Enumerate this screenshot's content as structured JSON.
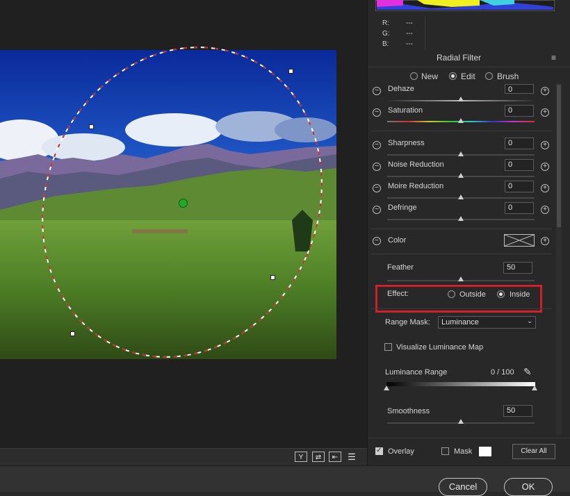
{
  "rgb": {
    "r_label": "R:",
    "g_label": "G:",
    "b_label": "B:",
    "r_value": "---",
    "g_value": "---",
    "b_value": "---"
  },
  "panel": {
    "title": "Radial Filter",
    "menu_icon": "hamburger-icon"
  },
  "modes": {
    "new": "New",
    "edit": "Edit",
    "brush": "Brush",
    "selected": "Edit"
  },
  "adjustments": {
    "dehaze": {
      "label": "Dehaze",
      "value": "0"
    },
    "saturation": {
      "label": "Saturation",
      "value": "0"
    },
    "sharpness": {
      "label": "Sharpness",
      "value": "0"
    },
    "noise_reduction": {
      "label": "Noise Reduction",
      "value": "0"
    },
    "moire_reduction": {
      "label": "Moire Reduction",
      "value": "0"
    },
    "defringe": {
      "label": "Defringe",
      "value": "0"
    },
    "color": {
      "label": "Color"
    }
  },
  "feather": {
    "label": "Feather",
    "value": "50"
  },
  "effect": {
    "label": "Effect:",
    "outside": "Outside",
    "inside": "Inside",
    "selected": "Inside"
  },
  "range_mask": {
    "label": "Range Mask:",
    "value": "Luminance"
  },
  "visualize": {
    "label": "Visualize Luminance Map",
    "checked": false
  },
  "luminance_range": {
    "label": "Luminance Range",
    "value": "0 / 100"
  },
  "smoothness": {
    "label": "Smoothness",
    "value": "50"
  },
  "footer": {
    "overlay": "Overlay",
    "overlay_checked": true,
    "mask": "Mask",
    "mask_checked": false,
    "clear_all": "Clear All"
  },
  "dialog": {
    "cancel": "Cancel",
    "ok": "OK"
  },
  "toolbar": {
    "y_icon": "Y",
    "icons": [
      "y-compare-icon",
      "swap-icon",
      "copy-settings-icon",
      "sliders-icon"
    ]
  },
  "colors": {
    "highlight": "#d0202a",
    "pin": "#1faa2a"
  }
}
